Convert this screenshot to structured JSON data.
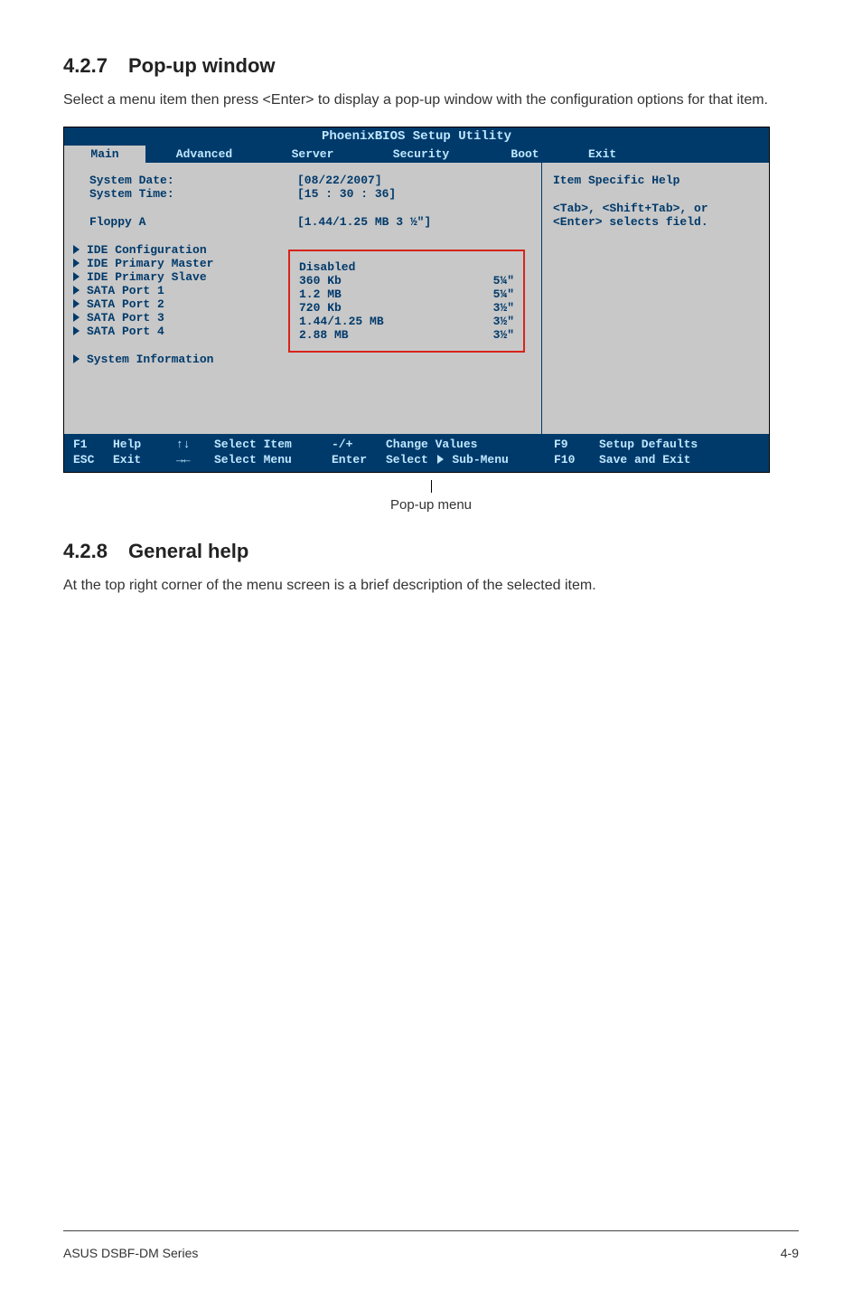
{
  "sections": {
    "popup": {
      "num": "4.2.7",
      "title": "Pop-up window",
      "text": "Select a menu item then press <Enter> to display a pop-up window with the configuration options for that item."
    },
    "general": {
      "num": "4.2.8",
      "title": "General help",
      "text": "At the top right corner of the menu screen is a brief description of the selected item."
    }
  },
  "bios": {
    "title": "PhoenixBIOS Setup Utility",
    "tabs": {
      "main": "Main",
      "advanced": "Advanced",
      "server": "Server",
      "security": "Security",
      "boot": "Boot",
      "exit": "Exit"
    },
    "fields": {
      "system_date_label": "System Date:",
      "system_date_value": "[08/22/2007]",
      "system_time_label": "System Time:",
      "system_time_value": "[15 : 30 : 36]",
      "floppy_label": "Floppy A",
      "floppy_value": "[1.44/1.25 MB  3 ½\"]"
    },
    "submenus": [
      "IDE Configuration",
      "IDE Primary Master",
      "IDE Primary Slave",
      "SATA Port 1",
      "SATA Port 2",
      "SATA Port 3",
      "SATA Port 4"
    ],
    "system_info": "System Information",
    "help_title": "Item Specific Help",
    "help_text": "<Tab>, <Shift+Tab>, or <Enter> selects field.",
    "popup_items": [
      {
        "l": "Disabled",
        "r": ""
      },
      {
        "l": "360 Kb",
        "r": "5¼\""
      },
      {
        "l": "1.2 MB",
        "r": "5¼\""
      },
      {
        "l": "720 Kb",
        "r": "3½\""
      },
      {
        "l": "1.44/1.25 MB",
        "r": "3½\""
      },
      {
        "l": "2.88 MB",
        "r": "3½\""
      }
    ],
    "footer": {
      "l1": {
        "k": "F1",
        "a": "Help",
        "arr": "↑↓",
        "lab": "Select Item",
        "pm": "-/+",
        "cv": "Change Values",
        "rk": "F9",
        "rl": "Setup Defaults"
      },
      "l2": {
        "k": "ESC",
        "a": "Exit",
        "arr": "→←",
        "lab": "Select Menu",
        "pm": "Enter",
        "cv": "Select   Sub-Menu",
        "rk": "F10",
        "rl": "Save and Exit"
      }
    }
  },
  "caption": "Pop-up menu",
  "footer_left": "ASUS DSBF-DM Series",
  "footer_right": "4-9"
}
